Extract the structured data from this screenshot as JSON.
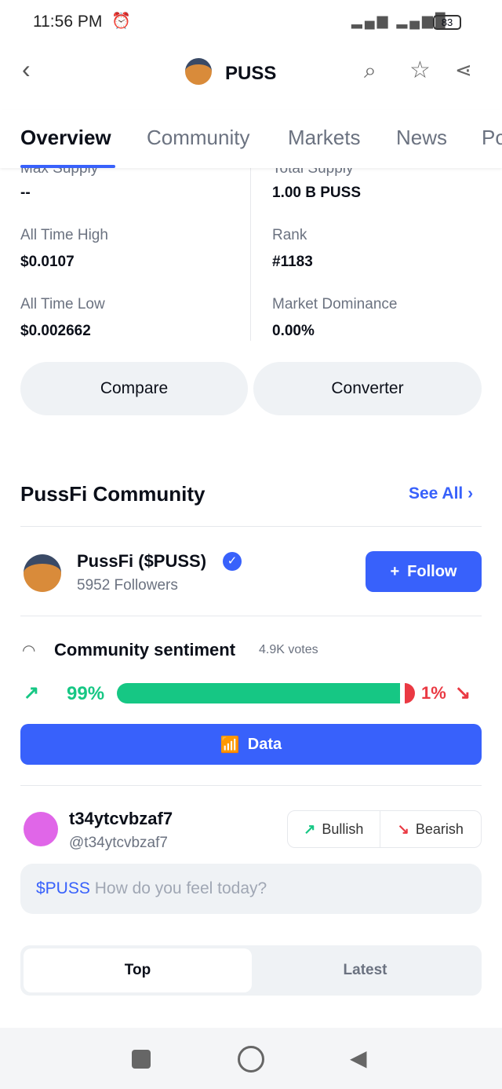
{
  "status_bar": {
    "time": "11:56 PM",
    "battery": "83"
  },
  "header": {
    "title": "PUSS"
  },
  "tabs": [
    "Overview",
    "Community",
    "Markets",
    "News",
    "Po"
  ],
  "stats": {
    "max_supply": {
      "label": "Max Supply",
      "value": "--"
    },
    "total_supply": {
      "label": "Total Supply",
      "value": "1.00 B PUSS"
    },
    "ath": {
      "label": "All Time High",
      "value": "$0.0107"
    },
    "rank": {
      "label": "Rank",
      "value": "#1183"
    },
    "atl": {
      "label": "All Time Low",
      "value": "$0.002662"
    },
    "dominance": {
      "label": "Market Dominance",
      "value": "0.00%"
    }
  },
  "buttons": {
    "compare": "Compare",
    "converter": "Converter"
  },
  "community": {
    "title": "PussFi Community",
    "see_all": "See All",
    "name": "PussFi ($PUSS)",
    "followers": "5952 Followers",
    "follow": "Follow",
    "sentiment_title": "Community sentiment",
    "votes": "4.9K votes",
    "bullish_pct": "99%",
    "bearish_pct": "1%",
    "bullish_fraction": 0.99,
    "data_btn": "Data",
    "colors": {
      "bull": "#16c784",
      "bear": "#ea3943",
      "accent": "#3861fb"
    }
  },
  "user": {
    "name": "t34ytcvbzaf7",
    "handle": "@t34ytcvbzaf7",
    "bullish": "Bullish",
    "bearish": "Bearish",
    "input_tag": "$PUSS",
    "input_placeholder": "How do you feel today?"
  },
  "feed_tabs": {
    "top": "Top",
    "latest": "Latest"
  }
}
